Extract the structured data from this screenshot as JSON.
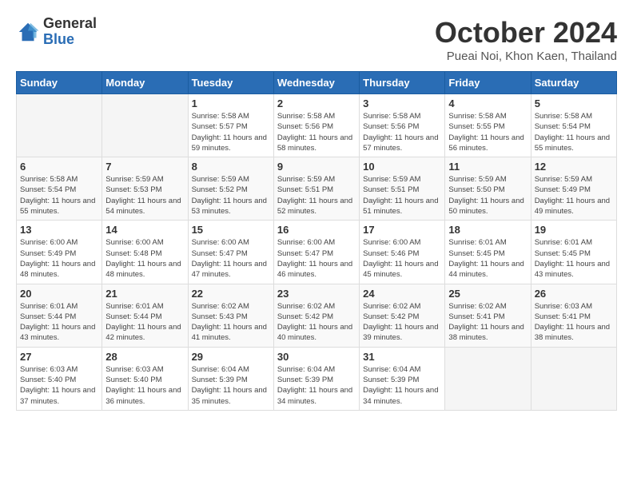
{
  "logo": {
    "general": "General",
    "blue": "Blue"
  },
  "title": "October 2024",
  "location": "Pueai Noi, Khon Kaen, Thailand",
  "days_of_week": [
    "Sunday",
    "Monday",
    "Tuesday",
    "Wednesday",
    "Thursday",
    "Friday",
    "Saturday"
  ],
  "weeks": [
    [
      {
        "day": "",
        "info": ""
      },
      {
        "day": "",
        "info": ""
      },
      {
        "day": "1",
        "sunrise": "5:58 AM",
        "sunset": "5:57 PM",
        "daylight": "11 hours and 59 minutes."
      },
      {
        "day": "2",
        "sunrise": "5:58 AM",
        "sunset": "5:56 PM",
        "daylight": "11 hours and 58 minutes."
      },
      {
        "day": "3",
        "sunrise": "5:58 AM",
        "sunset": "5:56 PM",
        "daylight": "11 hours and 57 minutes."
      },
      {
        "day": "4",
        "sunrise": "5:58 AM",
        "sunset": "5:55 PM",
        "daylight": "11 hours and 56 minutes."
      },
      {
        "day": "5",
        "sunrise": "5:58 AM",
        "sunset": "5:54 PM",
        "daylight": "11 hours and 55 minutes."
      }
    ],
    [
      {
        "day": "6",
        "sunrise": "5:58 AM",
        "sunset": "5:54 PM",
        "daylight": "11 hours and 55 minutes."
      },
      {
        "day": "7",
        "sunrise": "5:59 AM",
        "sunset": "5:53 PM",
        "daylight": "11 hours and 54 minutes."
      },
      {
        "day": "8",
        "sunrise": "5:59 AM",
        "sunset": "5:52 PM",
        "daylight": "11 hours and 53 minutes."
      },
      {
        "day": "9",
        "sunrise": "5:59 AM",
        "sunset": "5:51 PM",
        "daylight": "11 hours and 52 minutes."
      },
      {
        "day": "10",
        "sunrise": "5:59 AM",
        "sunset": "5:51 PM",
        "daylight": "11 hours and 51 minutes."
      },
      {
        "day": "11",
        "sunrise": "5:59 AM",
        "sunset": "5:50 PM",
        "daylight": "11 hours and 50 minutes."
      },
      {
        "day": "12",
        "sunrise": "5:59 AM",
        "sunset": "5:49 PM",
        "daylight": "11 hours and 49 minutes."
      }
    ],
    [
      {
        "day": "13",
        "sunrise": "6:00 AM",
        "sunset": "5:49 PM",
        "daylight": "11 hours and 48 minutes."
      },
      {
        "day": "14",
        "sunrise": "6:00 AM",
        "sunset": "5:48 PM",
        "daylight": "11 hours and 48 minutes."
      },
      {
        "day": "15",
        "sunrise": "6:00 AM",
        "sunset": "5:47 PM",
        "daylight": "11 hours and 47 minutes."
      },
      {
        "day": "16",
        "sunrise": "6:00 AM",
        "sunset": "5:47 PM",
        "daylight": "11 hours and 46 minutes."
      },
      {
        "day": "17",
        "sunrise": "6:00 AM",
        "sunset": "5:46 PM",
        "daylight": "11 hours and 45 minutes."
      },
      {
        "day": "18",
        "sunrise": "6:01 AM",
        "sunset": "5:45 PM",
        "daylight": "11 hours and 44 minutes."
      },
      {
        "day": "19",
        "sunrise": "6:01 AM",
        "sunset": "5:45 PM",
        "daylight": "11 hours and 43 minutes."
      }
    ],
    [
      {
        "day": "20",
        "sunrise": "6:01 AM",
        "sunset": "5:44 PM",
        "daylight": "11 hours and 43 minutes."
      },
      {
        "day": "21",
        "sunrise": "6:01 AM",
        "sunset": "5:44 PM",
        "daylight": "11 hours and 42 minutes."
      },
      {
        "day": "22",
        "sunrise": "6:02 AM",
        "sunset": "5:43 PM",
        "daylight": "11 hours and 41 minutes."
      },
      {
        "day": "23",
        "sunrise": "6:02 AM",
        "sunset": "5:42 PM",
        "daylight": "11 hours and 40 minutes."
      },
      {
        "day": "24",
        "sunrise": "6:02 AM",
        "sunset": "5:42 PM",
        "daylight": "11 hours and 39 minutes."
      },
      {
        "day": "25",
        "sunrise": "6:02 AM",
        "sunset": "5:41 PM",
        "daylight": "11 hours and 38 minutes."
      },
      {
        "day": "26",
        "sunrise": "6:03 AM",
        "sunset": "5:41 PM",
        "daylight": "11 hours and 38 minutes."
      }
    ],
    [
      {
        "day": "27",
        "sunrise": "6:03 AM",
        "sunset": "5:40 PM",
        "daylight": "11 hours and 37 minutes."
      },
      {
        "day": "28",
        "sunrise": "6:03 AM",
        "sunset": "5:40 PM",
        "daylight": "11 hours and 36 minutes."
      },
      {
        "day": "29",
        "sunrise": "6:04 AM",
        "sunset": "5:39 PM",
        "daylight": "11 hours and 35 minutes."
      },
      {
        "day": "30",
        "sunrise": "6:04 AM",
        "sunset": "5:39 PM",
        "daylight": "11 hours and 34 minutes."
      },
      {
        "day": "31",
        "sunrise": "6:04 AM",
        "sunset": "5:39 PM",
        "daylight": "11 hours and 34 minutes."
      },
      {
        "day": "",
        "info": ""
      },
      {
        "day": "",
        "info": ""
      }
    ]
  ],
  "labels": {
    "sunrise_prefix": "Sunrise: ",
    "sunset_prefix": "Sunset: ",
    "daylight_prefix": "Daylight: "
  }
}
